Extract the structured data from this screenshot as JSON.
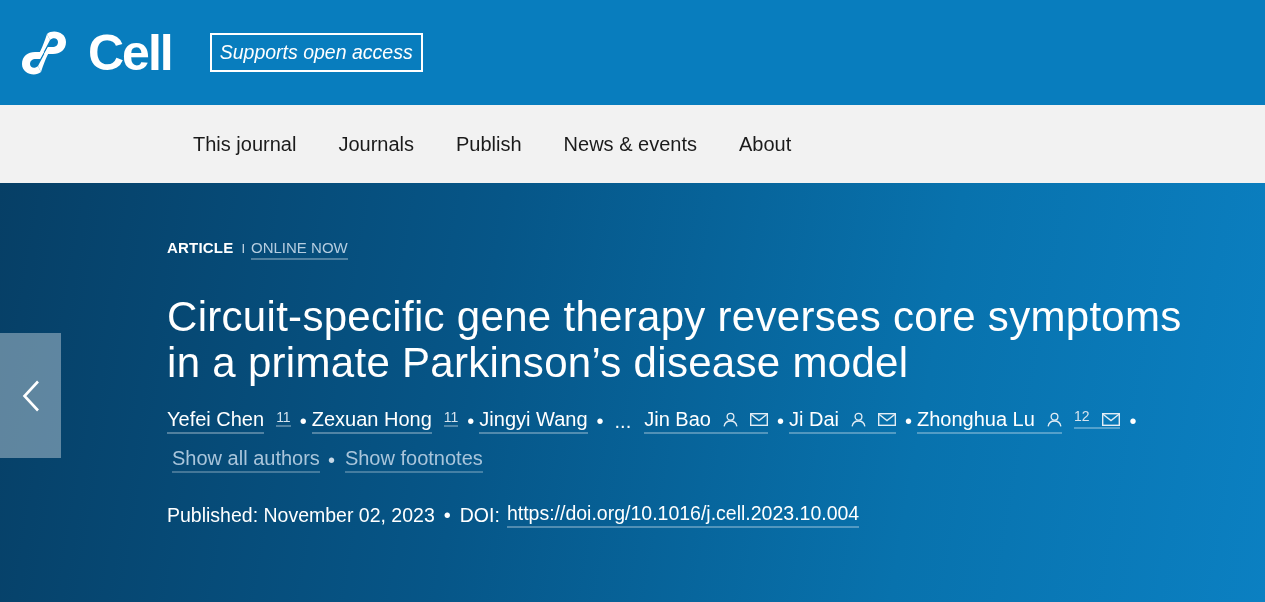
{
  "header": {
    "logo_text": "Cell",
    "badge": "Supports open access"
  },
  "nav": {
    "items": [
      "This journal",
      "Journals",
      "Publish",
      "News & events",
      "About"
    ]
  },
  "article": {
    "type": "ARTICLE",
    "divider": "I",
    "status": "ONLINE NOW",
    "title": "Circuit-specific gene therapy reverses core symptoms in a primate Parkinson’s disease model",
    "authors": [
      {
        "kind": "author",
        "name": "Yefei Chen",
        "profile": false,
        "note": "11",
        "email": false,
        "separator": "•"
      },
      {
        "kind": "author",
        "name": "Zexuan Hong",
        "profile": false,
        "note": "11",
        "email": false,
        "separator": "•"
      },
      {
        "kind": "author",
        "name": "Jingyi Wang",
        "profile": false,
        "email": false,
        "separator": "•"
      },
      {
        "kind": "more",
        "text": "..."
      },
      {
        "kind": "author",
        "name": "Jin Bao",
        "profile": true,
        "email": true,
        "separator": "•"
      },
      {
        "kind": "author",
        "name": "Ji Dai",
        "profile": true,
        "email": true,
        "separator": "•"
      },
      {
        "kind": "author",
        "name": "Zhonghua Lu",
        "profile": true,
        "note": "12",
        "email": true,
        "separator": "•"
      }
    ],
    "author_links": {
      "items": [
        "Show all authors",
        "Show footnotes"
      ],
      "separator": "•"
    },
    "published": "Published: November 02, 2023",
    "meta_separator": "•",
    "doi_label": "DOI:",
    "doi": "https://doi.org/10.1016/j.cell.2023.10.004"
  }
}
